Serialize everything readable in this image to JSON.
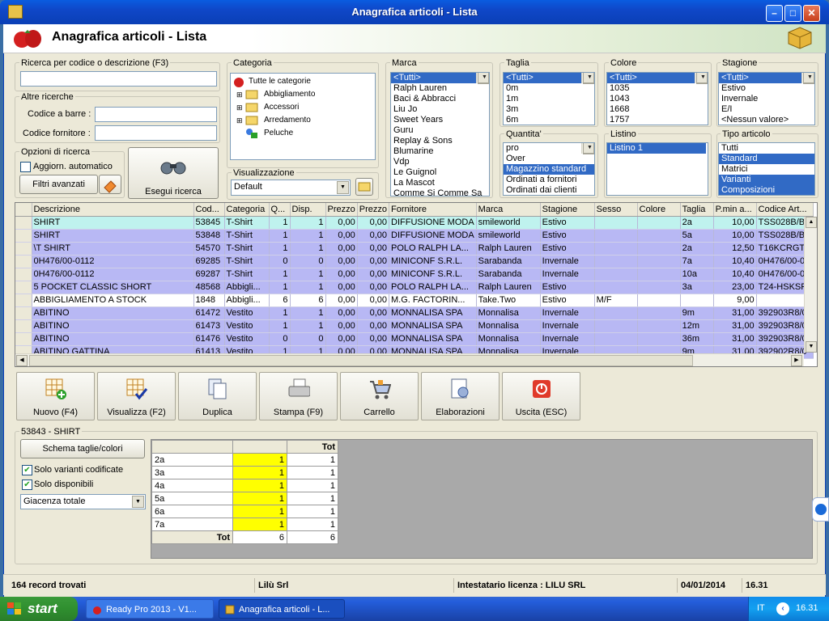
{
  "window": {
    "title": "Anagrafica articoli  - Lista",
    "header_title": "Anagrafica articoli  - Lista"
  },
  "search": {
    "label": "Ricerca per codice o descrizione (F3)",
    "value": ""
  },
  "altre": {
    "label": "Altre ricerche",
    "barcode_label": "Codice a barre :",
    "supplier_label": "Codice fornitore :"
  },
  "opzioni": {
    "label": "Opzioni di ricerca",
    "auto_label": "Aggiorn. automatico",
    "advanced_label": "Filtri avanzati",
    "search_button": "Esegui ricerca"
  },
  "categoria": {
    "label": "Categoria",
    "root": "Tutte le categorie",
    "items": [
      "Abbigliamento",
      "Accessori",
      "Arredamento",
      "Peluche"
    ]
  },
  "visualizzazione": {
    "label": "Visualizzazione",
    "value": "Default"
  },
  "marca": {
    "label": "Marca",
    "items": [
      "<Tutti>",
      "Ralph Lauren",
      "Baci & Abbracci",
      "Liu Jo",
      "Sweet Years",
      "Guru",
      "Replay & Sons",
      "Blumarine",
      "Vdp",
      "Le Guignol",
      "La Mascot",
      "Comme Si Comme Sa"
    ]
  },
  "taglia": {
    "label": "Taglia",
    "items": [
      "<Tutti>",
      "0m",
      "1m",
      "3m",
      "6m"
    ]
  },
  "colore": {
    "label": "Colore",
    "items": [
      "<Tutti>",
      "1035",
      "1043",
      "1668",
      "1757"
    ]
  },
  "stagione": {
    "label": "Stagione",
    "items": [
      "<Tutti>",
      "Estivo",
      "Invernale",
      "E/I",
      "<Nessun valore>"
    ]
  },
  "quantita": {
    "label": "Quantita'",
    "items": [
      "pro",
      "Over",
      "Magazzino standard",
      "Ordinati a fornitori",
      "Ordinati dai clienti"
    ]
  },
  "listino": {
    "label": "Listino",
    "items": [
      "Listino 1"
    ]
  },
  "tipo": {
    "label": "Tipo articolo",
    "items": [
      "Tutti",
      "Standard",
      "Matrici",
      "Varianti",
      "Composizioni"
    ]
  },
  "grid": {
    "columns": [
      "Descrizione",
      "Cod...",
      "Categoria",
      "Q...",
      "Disp.",
      "Prezzo",
      "Prezzo",
      "Fornitore",
      "Marca",
      "Stagione",
      "Sesso",
      "Colore",
      "Taglia",
      "P.min a...",
      "Codice Art..."
    ],
    "rows": [
      [
        "SHIRT",
        "53845",
        "T-Shirt",
        "1",
        "1",
        "0,00",
        "0,00",
        "DIFFUSIONE MODA",
        "smileworld",
        "Estivo",
        "",
        "",
        "2a",
        "10,00",
        "TSS028B/BI"
      ],
      [
        "SHIRT",
        "53848",
        "T-Shirt",
        "1",
        "1",
        "0,00",
        "0,00",
        "DIFFUSIONE MODA",
        "smileworld",
        "Estivo",
        "",
        "",
        "5a",
        "10,00",
        "TSS028B/BI"
      ],
      [
        "\\T SHIRT",
        "54570",
        "T-Shirt",
        "1",
        "1",
        "0,00",
        "0,00",
        "POLO RALPH LA...",
        "Ralph Lauren",
        "Estivo",
        "",
        "",
        "2a",
        "12,50",
        "T16KCRGT/"
      ],
      [
        "0H476/00-0112",
        "69285",
        "T-Shirt",
        "0",
        "0",
        "0,00",
        "0,00",
        "MINICONF S.R.L.",
        "Sarabanda",
        "Invernale",
        "",
        "",
        "7a",
        "10,40",
        "0H476/00-0"
      ],
      [
        "0H476/00-0112",
        "69287",
        "T-Shirt",
        "1",
        "1",
        "0,00",
        "0,00",
        "MINICONF S.R.L.",
        "Sarabanda",
        "Invernale",
        "",
        "",
        "10a",
        "10,40",
        "0H476/00-0"
      ],
      [
        "5 POCKET CLASSIC SHORT",
        "48568",
        "Abbigli...",
        "1",
        "1",
        "0,00",
        "0,00",
        "POLO RALPH LA...",
        "Ralph Lauren",
        "Estivo",
        "",
        "",
        "3a",
        "23,00",
        "T24-HSKSR/"
      ],
      [
        "ABBIGLIAMENTO A STOCK",
        "1848",
        "Abbigli...",
        "6",
        "6",
        "0,00",
        "0,00",
        "M.G. FACTORIN...",
        "Take.Two",
        "Estivo",
        "M/F",
        "",
        "",
        "9,00",
        ""
      ],
      [
        "ABITINO",
        "61472",
        "Vestito",
        "1",
        "1",
        "0,00",
        "0,00",
        "MONNALISA SPA",
        "Monnalisa",
        "Invernale",
        "",
        "",
        "9m",
        "31,00",
        "392903R8/0"
      ],
      [
        "ABITINO",
        "61473",
        "Vestito",
        "1",
        "1",
        "0,00",
        "0,00",
        "MONNALISA SPA",
        "Monnalisa",
        "Invernale",
        "",
        "",
        "12m",
        "31,00",
        "392903R8/0"
      ],
      [
        "ABITINO",
        "61476",
        "Vestito",
        "0",
        "0",
        "0,00",
        "0,00",
        "MONNALISA SPA",
        "Monnalisa",
        "Invernale",
        "",
        "",
        "36m",
        "31,00",
        "392903R8/0"
      ],
      [
        "ABITINO GATTINA",
        "61413",
        "Vestito",
        "1",
        "1",
        "0,00",
        "0,00",
        "MONNALISA SPA",
        "Monnalisa",
        "Invernale",
        "",
        "",
        "9m",
        "31,00",
        "392902R8/0"
      ]
    ]
  },
  "toolbar": {
    "new": "Nuovo (F4)",
    "view": "Visualizza (F2)",
    "duplicate": "Duplica",
    "print": "Stampa (F9)",
    "cart": "Carrello",
    "process": "Elaborazioni",
    "exit": "Uscita (ESC)"
  },
  "detail": {
    "label": "53843 - SHIRT",
    "schema_button": "Schema taglie/colori",
    "only_coded": "Solo varianti codificate",
    "only_available": "Solo disponibili",
    "stock_select": "Giacenza totale",
    "table_header": "Tot",
    "sizes": [
      [
        "2a",
        "1",
        "1"
      ],
      [
        "3a",
        "1",
        "1"
      ],
      [
        "4a",
        "1",
        "1"
      ],
      [
        "5a",
        "1",
        "1"
      ],
      [
        "6a",
        "1",
        "1"
      ],
      [
        "7a",
        "1",
        "1"
      ]
    ],
    "total_label": "Tot",
    "total_values": [
      "6",
      "6"
    ]
  },
  "status": {
    "records": "164 record trovati",
    "company": "Lilù Srl",
    "license": "Intestatario licenza : LILU SRL",
    "date": "04/01/2014",
    "time": "16.31"
  },
  "taskbar": {
    "start": "start",
    "task1": "Ready Pro 2013 - V1...",
    "task2": "Anagrafica articoli - L...",
    "lang": "IT",
    "clock": "16.31"
  }
}
